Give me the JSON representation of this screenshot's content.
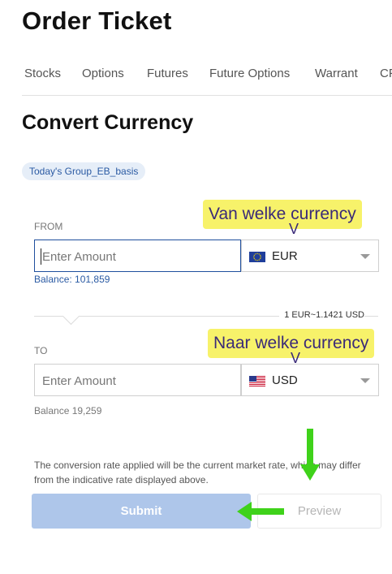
{
  "page": {
    "title": "Order Ticket"
  },
  "tabs": [
    {
      "label": "Stocks"
    },
    {
      "label": "Options"
    },
    {
      "label": "Futures"
    },
    {
      "label": "Future Options"
    },
    {
      "label": "Warrant"
    },
    {
      "label": "CF"
    }
  ],
  "convert": {
    "title": "Convert Currency",
    "group_badge": "Today's Group_EB_basis",
    "from": {
      "label": "FROM",
      "amount_placeholder": "Enter Amount",
      "currency": "EUR",
      "currency_flag": "eu-flag-icon",
      "balance": "Balance: 101,859"
    },
    "rate": "1 EUR~1.1421 USD",
    "to": {
      "label": "TO",
      "amount_placeholder": "Enter Amount",
      "currency": "USD",
      "currency_flag": "us-flag-icon",
      "balance": "Balance 19,259"
    },
    "note": "The conversion rate applied will be the current market rate, which may differ from the indicative rate displayed above.",
    "submit_label": "Submit",
    "preview_label": "Preview"
  },
  "annotations": {
    "from_callout": "Van welke currency",
    "to_callout": "Naar welke currency",
    "marker": "V",
    "colors": {
      "callout_bg": "#f7f26a",
      "callout_text": "#3a2a78",
      "arrow": "#3fd21a"
    }
  },
  "colors": {
    "accent": "#1f4f9d",
    "submit_bg": "#aec6ea",
    "badge_bg": "#e6eef8"
  }
}
